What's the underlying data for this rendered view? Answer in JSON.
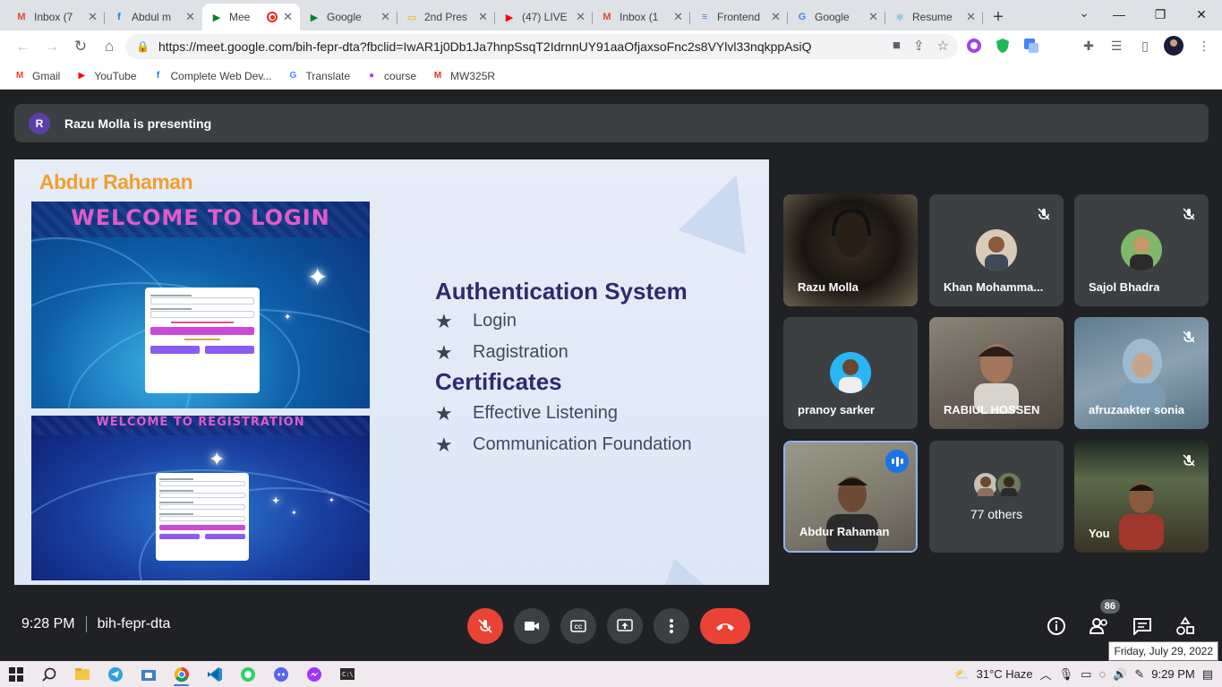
{
  "browser": {
    "tabs": [
      {
        "title": "Inbox (7",
        "icon": "gmail-icon",
        "color": "#ea4335",
        "glyph": "M"
      },
      {
        "title": "Abdul m",
        "icon": "facebook-icon",
        "color": "#1877f2",
        "glyph": "f"
      },
      {
        "title": "Mee",
        "icon": "meet-icon",
        "color": "#00832d",
        "glyph": "▶",
        "active": true,
        "recording": true
      },
      {
        "title": "Google",
        "icon": "meet-icon",
        "color": "#00832d",
        "glyph": "▶"
      },
      {
        "title": "2nd Pres",
        "icon": "slides-icon",
        "color": "#f4b400",
        "glyph": "▭"
      },
      {
        "title": "(47) LIVE",
        "icon": "youtube-icon",
        "color": "#ff0000",
        "glyph": "▶"
      },
      {
        "title": "Inbox (1",
        "icon": "gmail-icon",
        "color": "#ea4335",
        "glyph": "M"
      },
      {
        "title": "Frontend",
        "icon": "docs-icon",
        "color": "#4285f4",
        "glyph": "≡"
      },
      {
        "title": "Google",
        "icon": "translate-icon",
        "color": "#4285f4",
        "glyph": "G"
      },
      {
        "title": "Resume",
        "icon": "react-icon",
        "color": "#149eca",
        "glyph": "⚛"
      }
    ],
    "new_tab": "+",
    "url": "https://meet.google.com/bih-fepr-dta?fbclid=IwAR1j0Db1Ja7hnpSsqT2IdrnnUY91aaOfjaxsoFnc2s8VYlvl33nqkppAsiQ",
    "bookmarks": [
      {
        "label": "Gmail",
        "icon": "gmail-icon",
        "color": "#ea4335",
        "glyph": "M"
      },
      {
        "label": "YouTube",
        "icon": "youtube-icon",
        "color": "#ff0000",
        "glyph": "▶"
      },
      {
        "label": "Complete Web Dev...",
        "icon": "facebook-icon",
        "color": "#1877f2",
        "glyph": "f"
      },
      {
        "label": "Translate",
        "icon": "translate-icon",
        "color": "#4285f4",
        "glyph": "G"
      },
      {
        "label": "course",
        "icon": "course-icon",
        "color": "#a142f4",
        "glyph": "●"
      },
      {
        "label": "MW325R",
        "icon": "mw-icon",
        "color": "#d93025",
        "glyph": "M"
      }
    ]
  },
  "meet": {
    "presenting_initial": "R",
    "presenting_text": "Razu Molla is presenting",
    "slide": {
      "author": "Abdur Rahaman",
      "login_heading": "WELCOME TO LOGIN",
      "register_heading": "WELCOME TO REGISTRATION",
      "section1_title": "Authentication System",
      "section1_items": [
        "Login",
        "Ragistration"
      ],
      "section2_title": "Certificates",
      "section2_items": [
        "Effective Listening",
        "Communication Foundation"
      ],
      "bullet": "★"
    },
    "participants": [
      {
        "name": "Razu Molla",
        "muted": false,
        "type": "video"
      },
      {
        "name": "Khan Mohamma...",
        "muted": true,
        "type": "avatar"
      },
      {
        "name": "Sajol Bhadra",
        "muted": true,
        "type": "avatar"
      },
      {
        "name": "pranoy sarker",
        "muted": false,
        "type": "avatar"
      },
      {
        "name": "RABIUL HOSSEN",
        "muted": false,
        "type": "video"
      },
      {
        "name": "afruzaakter sonia",
        "muted": true,
        "type": "video"
      },
      {
        "name": "Abdur Rahaman",
        "muted": false,
        "type": "video",
        "speaking": true
      },
      {
        "name": "77 others",
        "muted": false,
        "type": "others"
      },
      {
        "name": "You",
        "muted": true,
        "type": "video"
      }
    ],
    "time": "9:28 PM",
    "meeting_code": "bih-fepr-dta",
    "participant_count": "86",
    "tooltip": "Friday, July 29, 2022"
  },
  "taskbar": {
    "weather": "31°C  Haze",
    "clock": "9:29 PM"
  }
}
